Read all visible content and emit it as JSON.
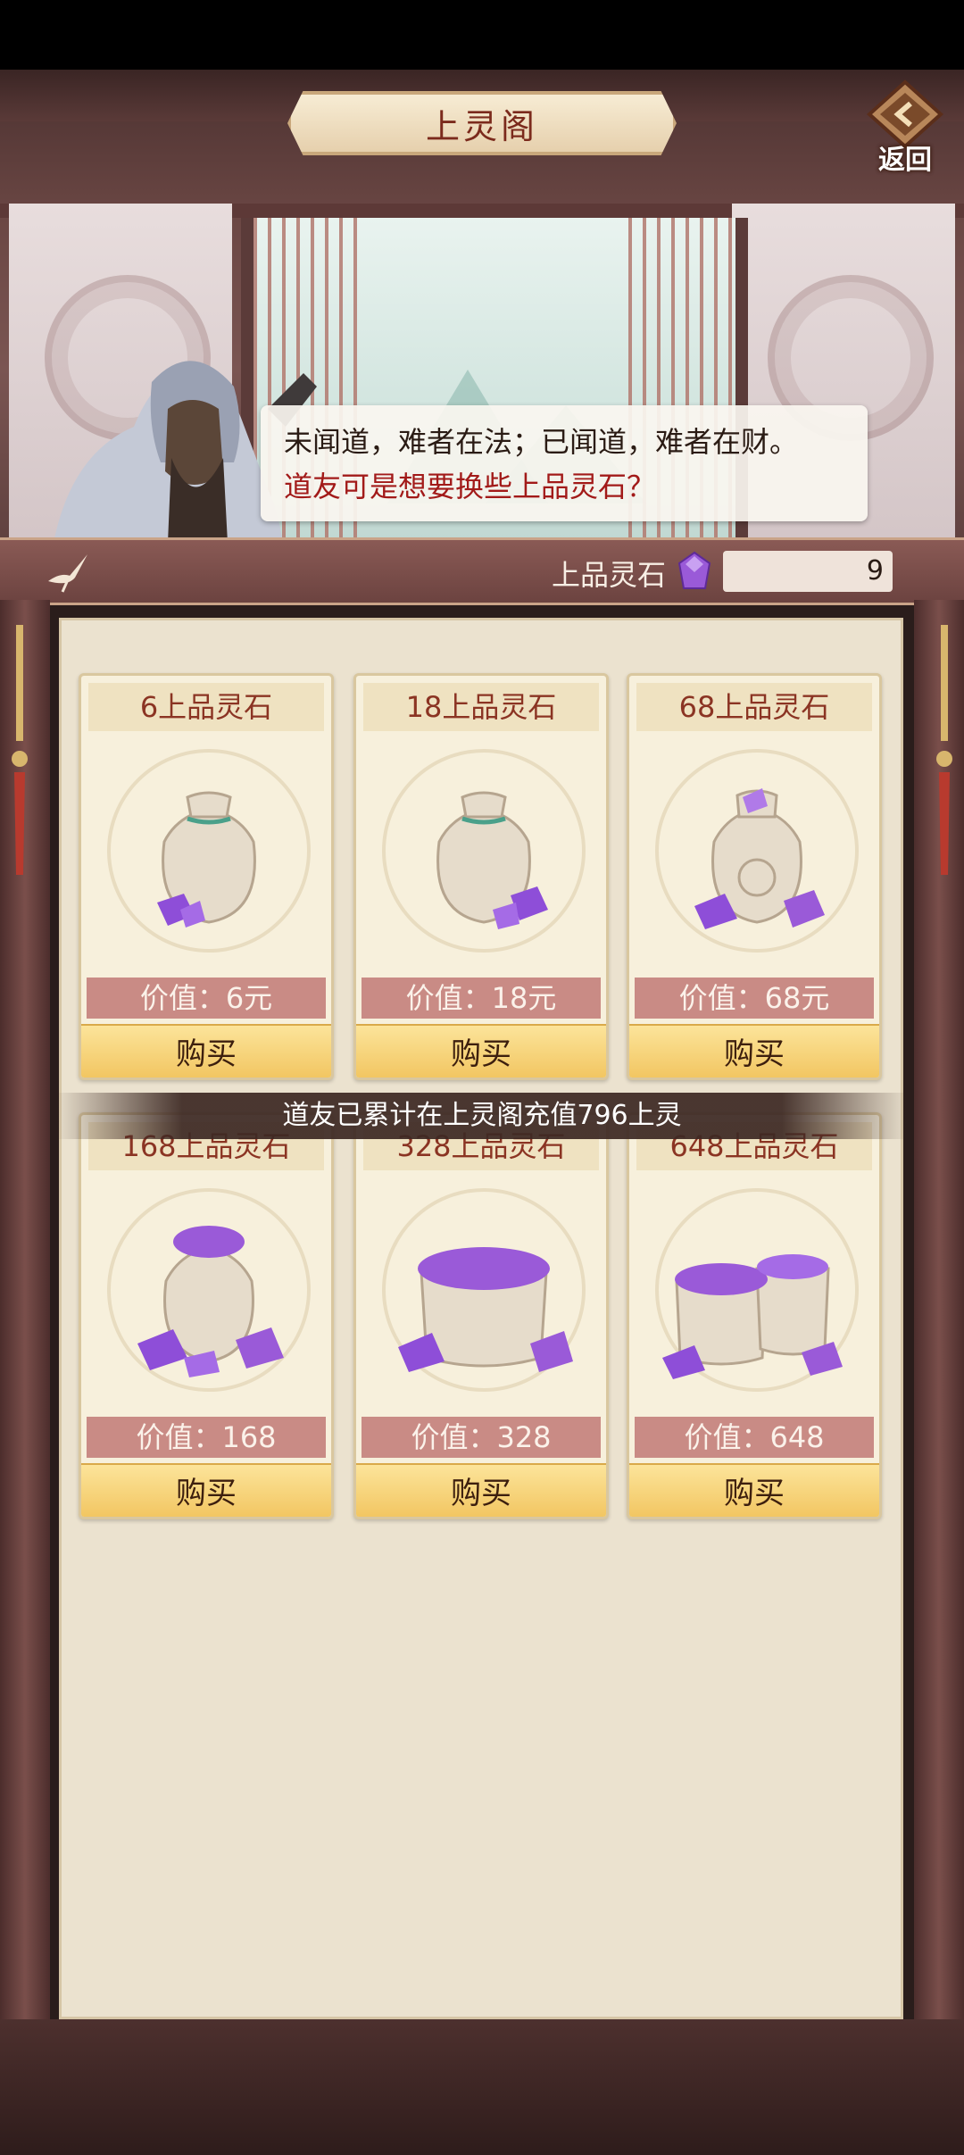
{
  "header": {
    "title": "上灵阁",
    "back_label": "返回"
  },
  "dialog": {
    "line1": "未闻道，难者在法；已闻道，难者在财。",
    "line2": "道友可是想要换些上品灵石？"
  },
  "currency": {
    "label": "上品灵石",
    "amount": "9",
    "icon": "purple-gem-icon"
  },
  "products": [
    {
      "title": "6上品灵石",
      "price": "价值：6元",
      "buy": "购买"
    },
    {
      "title": "18上品灵石",
      "price": "价值：18元",
      "buy": "购买"
    },
    {
      "title": "68上品灵石",
      "price": "价值：68元",
      "buy": "购买"
    },
    {
      "title": "168上品灵石",
      "price": "价值：168",
      "buy": "购买"
    },
    {
      "title": "328上品灵石",
      "price": "价值：328",
      "buy": "购买"
    },
    {
      "title": "648上品灵石",
      "price": "价值：648",
      "buy": "购买"
    }
  ],
  "notice": "道友已累计在上灵阁充值796上灵",
  "colors": {
    "accent": "#8b3423",
    "buy_button": "#f1c35c",
    "price_strip": "#c98b85",
    "gem": "#9a5ad8"
  }
}
